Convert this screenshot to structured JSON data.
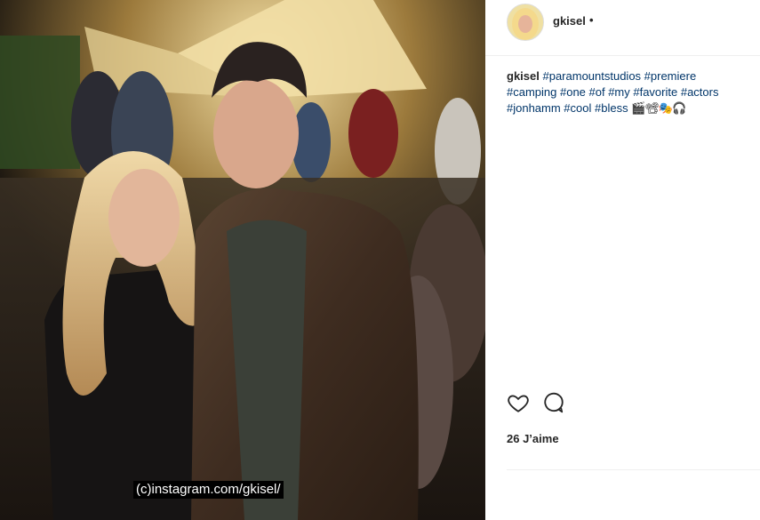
{
  "post": {
    "username": "gkisel",
    "separator": "•",
    "caption": {
      "author": "gkisel",
      "text": "#paramountstudios #premiere #camping #one #of #my #favorite #actors #jonhamm #cool #bless",
      "emoji": "🎬📽🎭🎧"
    },
    "likes": "26 J’aime",
    "watermark": "(c)instagram.com/gkisel/"
  },
  "icons": {
    "like": "heart-icon",
    "comment": "speech-bubble-icon"
  },
  "colors": {
    "hashtag": "#003569",
    "text": "#262626",
    "divider": "#efefef"
  }
}
